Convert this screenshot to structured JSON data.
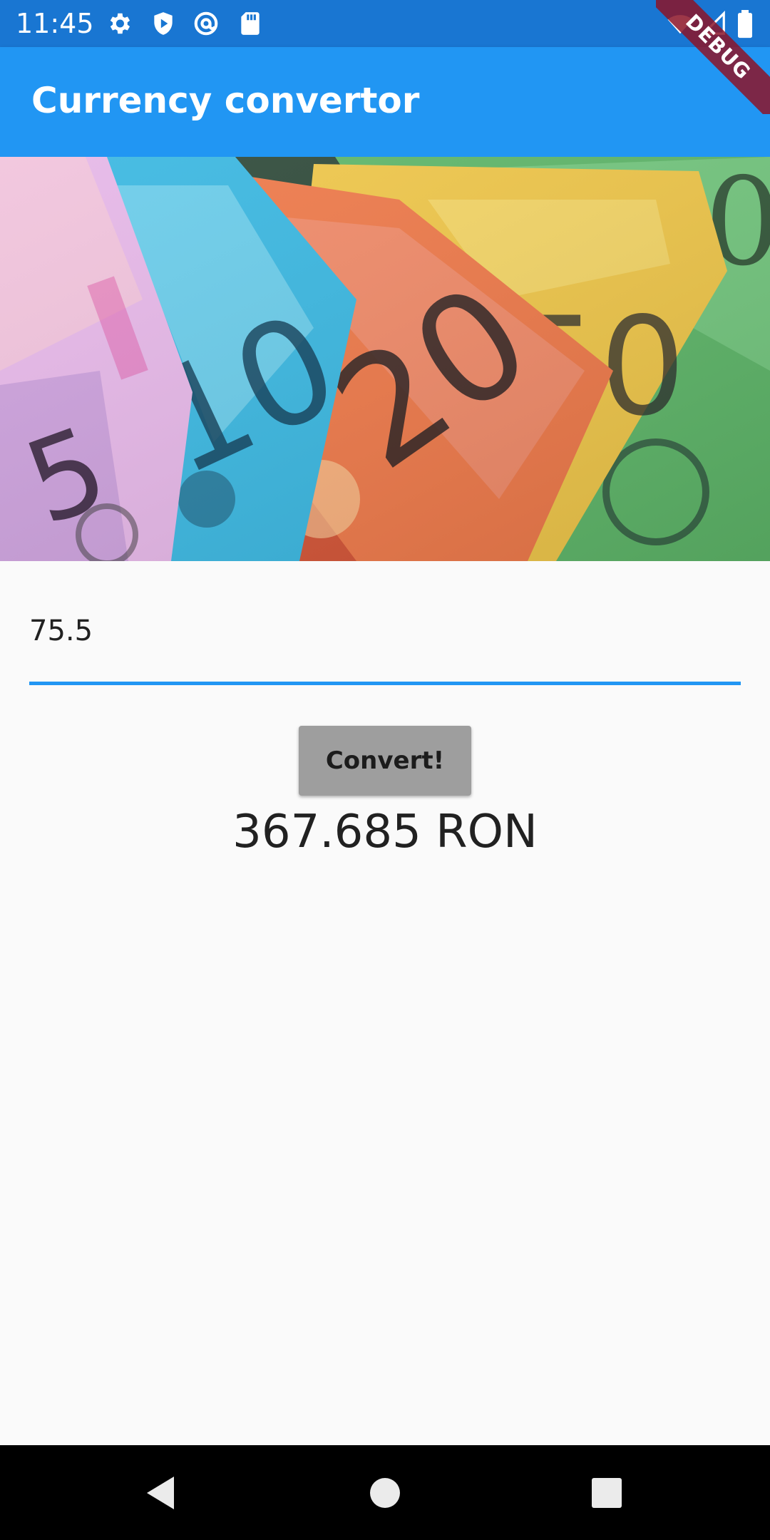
{
  "status_bar": {
    "time": "11:45",
    "left_icons": [
      "settings-icon",
      "shield-play-icon",
      "at-sign-icon",
      "sd-card-icon"
    ],
    "right_icons": [
      "wifi-icon",
      "signal-icon",
      "battery-icon"
    ],
    "background": "#1976d2"
  },
  "debug_banner": {
    "label": "DEBUG"
  },
  "app_bar": {
    "title": "Currency convertor",
    "background": "#2196f3"
  },
  "hero_image": {
    "subject": "banknotes-photo"
  },
  "amount_input": {
    "value": "75.5",
    "underline_color": "#2196f3"
  },
  "convert_button": {
    "label": "Convert!",
    "background": "#9e9e9e"
  },
  "result": {
    "text": "367.685 RON"
  },
  "nav_bar": {
    "buttons": [
      "back-icon",
      "home-icon",
      "recents-icon"
    ]
  }
}
